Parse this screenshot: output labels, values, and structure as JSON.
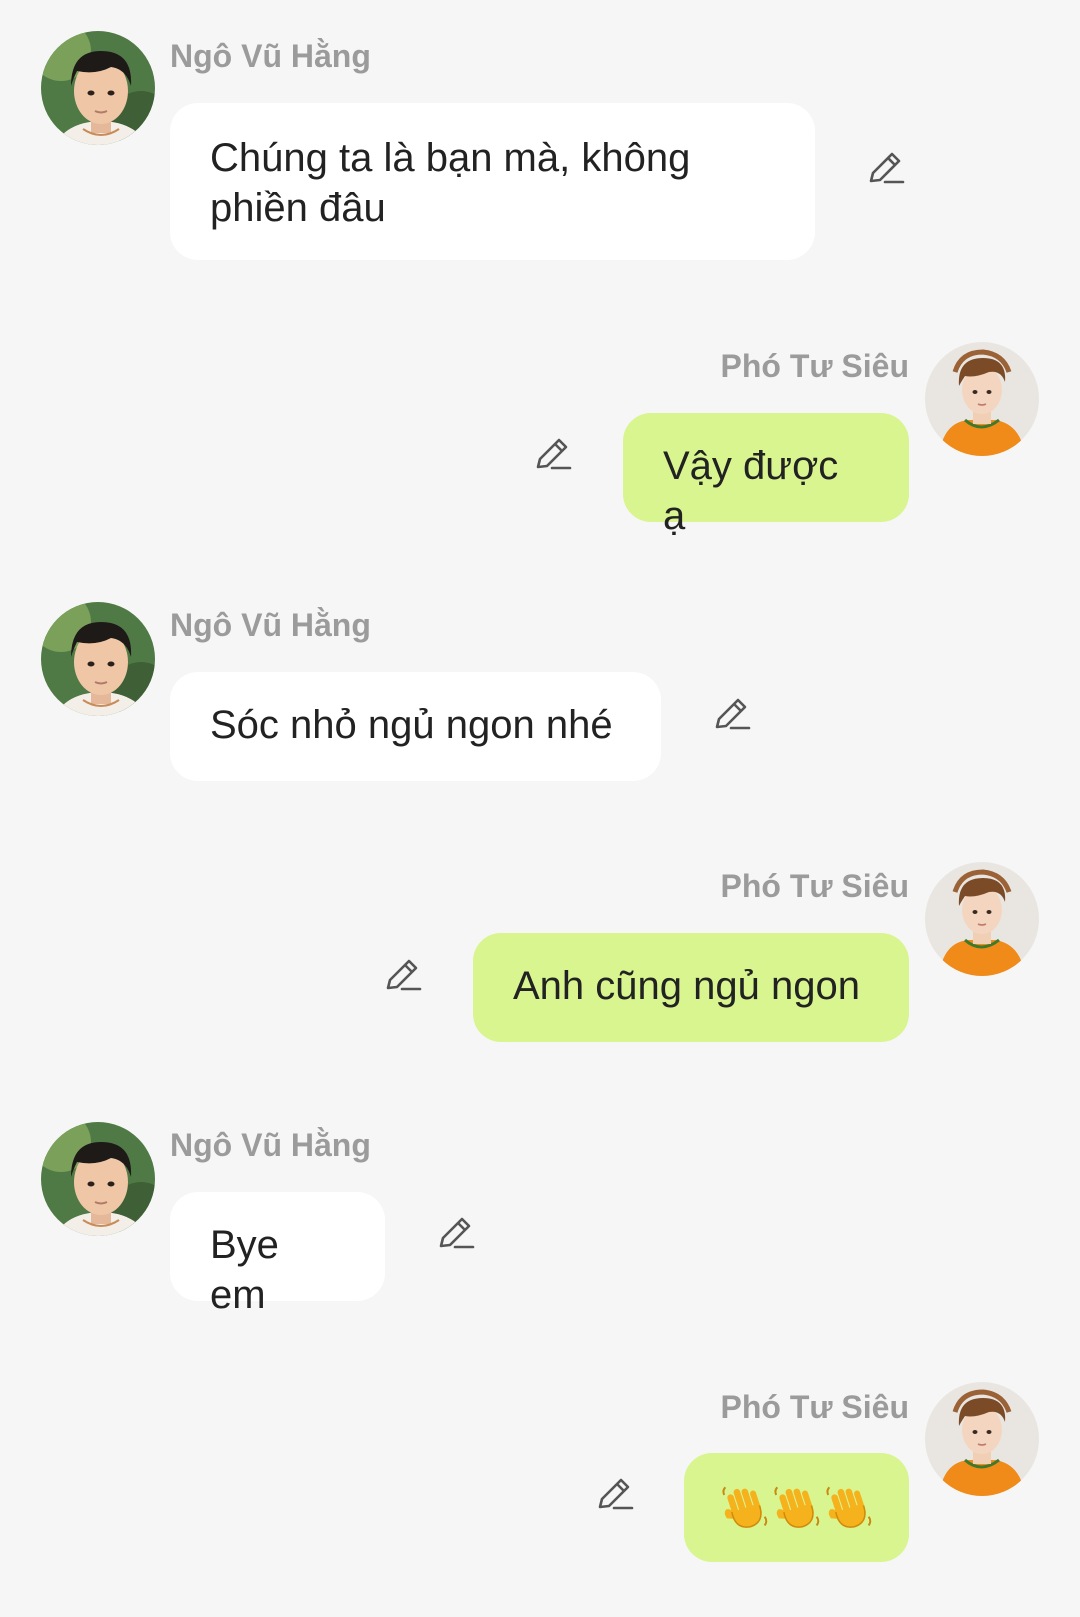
{
  "colors": {
    "background": "#f6f6f6",
    "bubble_them": "#ffffff",
    "bubble_me": "#d8f58f",
    "name_text": "#9b9b9b",
    "message_text": "#222222"
  },
  "messages": [
    {
      "sender": "Ngô Vũ Hằng",
      "side": "left",
      "lines": [
        "Chúng ta là bạn mà, không",
        "phiền đâu"
      ]
    },
    {
      "sender": "Phó Tư Siêu",
      "side": "right",
      "text": "Vậy được ạ"
    },
    {
      "sender": "Ngô Vũ Hằng",
      "side": "left",
      "text": "Sóc nhỏ ngủ ngon nhé"
    },
    {
      "sender": "Phó Tư Siêu",
      "side": "right",
      "text": "Anh cũng ngủ ngon"
    },
    {
      "sender": "Ngô Vũ Hằng",
      "side": "left",
      "text": "Bye em"
    },
    {
      "sender": "Phó Tư Siêu",
      "side": "right",
      "icon": "waving-hand-icon",
      "icon_count": 3
    }
  ],
  "icons": {
    "edit": "pencil-edit-icon",
    "wave": "waving-hand-icon",
    "avatar_left": "avatar-ngo-vu-hang",
    "avatar_right": "avatar-pho-tu-sieu"
  }
}
